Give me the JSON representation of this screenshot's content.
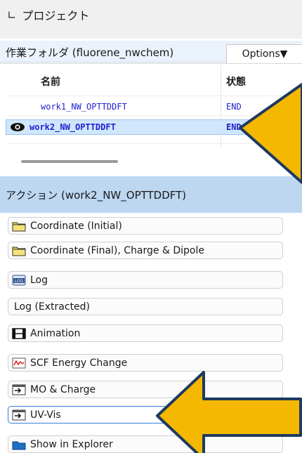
{
  "panel": {
    "title": "プロジェクト",
    "collapse_icon": "double-chevron-down-icon"
  },
  "folder": {
    "label": "作業フォルダ (fluorene_nwchem)",
    "options_label": "Options▼"
  },
  "table": {
    "columns": [
      "名前",
      "状態"
    ],
    "rows": [
      {
        "name": "work1_NW_OPTTDDFT",
        "status": "END",
        "selected": false
      },
      {
        "name": "work2_NW_OPTTDDFT",
        "status": "END",
        "selected": true
      }
    ],
    "selected_icon": "eye-icon"
  },
  "actions": {
    "header": "アクション (work2_NW_OPTTDDFT)",
    "buttons": [
      {
        "label": "Coordinate (Initial)",
        "icon": "folder-icon"
      },
      {
        "label": "Coordinate (Final), Charge & Dipole",
        "icon": "folder-icon"
      },
      {
        "label": "Log",
        "icon": "log-file-icon"
      },
      {
        "label": "Log (Extracted)",
        "icon": ""
      },
      {
        "label": "Animation",
        "icon": "film-icon"
      },
      {
        "label": "SCF Energy Change",
        "icon": "chart-icon"
      },
      {
        "label": "MO & Charge",
        "icon": "window-arrow-icon"
      },
      {
        "label": "UV-Vis",
        "icon": "window-arrow-icon",
        "selected": true
      },
      {
        "label": "Show in Explorer",
        "icon": "explorer-icon"
      }
    ]
  },
  "colors": {
    "accent_arrow": "#F5B800",
    "arrow_outline": "#1F3A5F",
    "selection": "#CFE6FB",
    "actions_header": "#BDD7F1"
  }
}
